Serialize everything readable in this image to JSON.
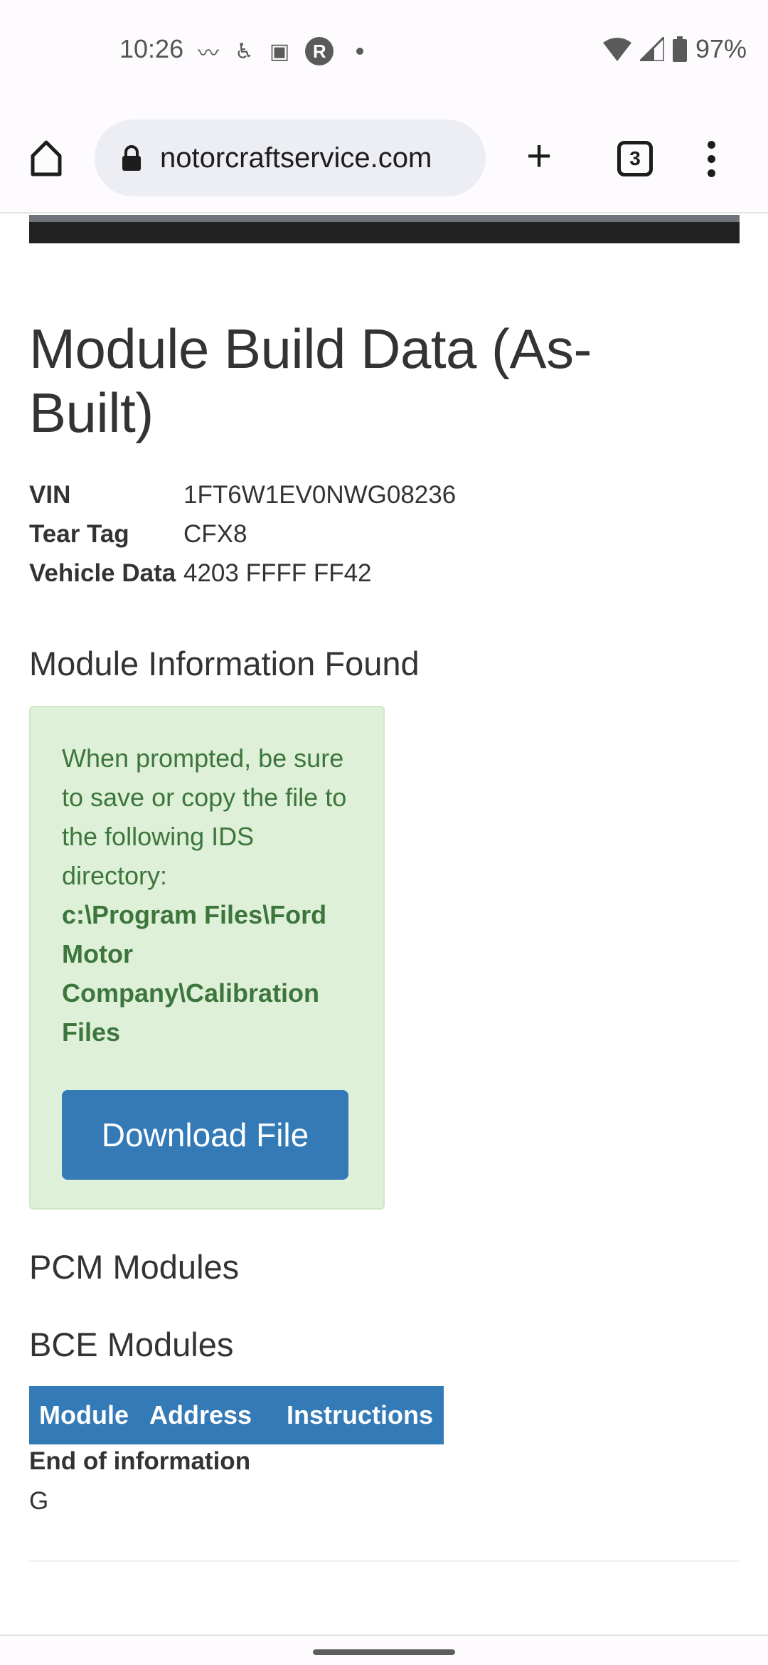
{
  "status_bar": {
    "time": "10:26",
    "battery": "97%",
    "notification_icons": [
      "shazam-like-icon",
      "accessibility-icon",
      "ok-badge-icon",
      "r-circle-icon",
      "dot-icon"
    ]
  },
  "browser": {
    "url": "notorcraftservice.com",
    "tab_count": "3"
  },
  "page": {
    "title": "Module Build Data (As-Built)",
    "vehicle": [
      {
        "label": "VIN",
        "value": "1FT6W1EV0NWG08236"
      },
      {
        "label": "Tear Tag",
        "value": "CFX8"
      },
      {
        "label": "Vehicle Data",
        "value": "4203 FFFF FF42"
      }
    ],
    "section_found": "Module Information Found",
    "alert": {
      "text": "When prompted, be sure to save or copy the file to the following IDS directory:",
      "path": "c:\\Program Files\\Ford Motor Company\\Calibration Files",
      "button": "Download File"
    },
    "pcm_heading": "PCM Modules",
    "bce_heading": "BCE Modules",
    "table_headers": [
      "Module",
      "Address",
      "Instructions"
    ],
    "end_text": "End of information",
    "trailing_text": "G"
  },
  "colors": {
    "primary": "#337ab7",
    "alert_bg": "#dff0d8",
    "alert_text": "#3c763d"
  }
}
